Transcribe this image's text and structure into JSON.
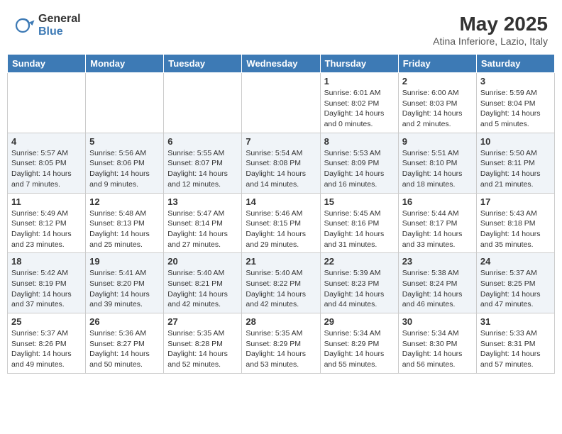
{
  "logo": {
    "general": "General",
    "blue": "Blue"
  },
  "title": "May 2025",
  "subtitle": "Atina Inferiore, Lazio, Italy",
  "weekdays": [
    "Sunday",
    "Monday",
    "Tuesday",
    "Wednesday",
    "Thursday",
    "Friday",
    "Saturday"
  ],
  "weeks": [
    [
      {
        "day": "",
        "detail": ""
      },
      {
        "day": "",
        "detail": ""
      },
      {
        "day": "",
        "detail": ""
      },
      {
        "day": "",
        "detail": ""
      },
      {
        "day": "1",
        "detail": "Sunrise: 6:01 AM\nSunset: 8:02 PM\nDaylight: 14 hours\nand 0 minutes."
      },
      {
        "day": "2",
        "detail": "Sunrise: 6:00 AM\nSunset: 8:03 PM\nDaylight: 14 hours\nand 2 minutes."
      },
      {
        "day": "3",
        "detail": "Sunrise: 5:59 AM\nSunset: 8:04 PM\nDaylight: 14 hours\nand 5 minutes."
      }
    ],
    [
      {
        "day": "4",
        "detail": "Sunrise: 5:57 AM\nSunset: 8:05 PM\nDaylight: 14 hours\nand 7 minutes."
      },
      {
        "day": "5",
        "detail": "Sunrise: 5:56 AM\nSunset: 8:06 PM\nDaylight: 14 hours\nand 9 minutes."
      },
      {
        "day": "6",
        "detail": "Sunrise: 5:55 AM\nSunset: 8:07 PM\nDaylight: 14 hours\nand 12 minutes."
      },
      {
        "day": "7",
        "detail": "Sunrise: 5:54 AM\nSunset: 8:08 PM\nDaylight: 14 hours\nand 14 minutes."
      },
      {
        "day": "8",
        "detail": "Sunrise: 5:53 AM\nSunset: 8:09 PM\nDaylight: 14 hours\nand 16 minutes."
      },
      {
        "day": "9",
        "detail": "Sunrise: 5:51 AM\nSunset: 8:10 PM\nDaylight: 14 hours\nand 18 minutes."
      },
      {
        "day": "10",
        "detail": "Sunrise: 5:50 AM\nSunset: 8:11 PM\nDaylight: 14 hours\nand 21 minutes."
      }
    ],
    [
      {
        "day": "11",
        "detail": "Sunrise: 5:49 AM\nSunset: 8:12 PM\nDaylight: 14 hours\nand 23 minutes."
      },
      {
        "day": "12",
        "detail": "Sunrise: 5:48 AM\nSunset: 8:13 PM\nDaylight: 14 hours\nand 25 minutes."
      },
      {
        "day": "13",
        "detail": "Sunrise: 5:47 AM\nSunset: 8:14 PM\nDaylight: 14 hours\nand 27 minutes."
      },
      {
        "day": "14",
        "detail": "Sunrise: 5:46 AM\nSunset: 8:15 PM\nDaylight: 14 hours\nand 29 minutes."
      },
      {
        "day": "15",
        "detail": "Sunrise: 5:45 AM\nSunset: 8:16 PM\nDaylight: 14 hours\nand 31 minutes."
      },
      {
        "day": "16",
        "detail": "Sunrise: 5:44 AM\nSunset: 8:17 PM\nDaylight: 14 hours\nand 33 minutes."
      },
      {
        "day": "17",
        "detail": "Sunrise: 5:43 AM\nSunset: 8:18 PM\nDaylight: 14 hours\nand 35 minutes."
      }
    ],
    [
      {
        "day": "18",
        "detail": "Sunrise: 5:42 AM\nSunset: 8:19 PM\nDaylight: 14 hours\nand 37 minutes."
      },
      {
        "day": "19",
        "detail": "Sunrise: 5:41 AM\nSunset: 8:20 PM\nDaylight: 14 hours\nand 39 minutes."
      },
      {
        "day": "20",
        "detail": "Sunrise: 5:40 AM\nSunset: 8:21 PM\nDaylight: 14 hours\nand 42 minutes."
      },
      {
        "day": "21",
        "detail": "Sunrise: 5:40 AM\nSunset: 8:22 PM\nDaylight: 14 hours\nand 42 minutes."
      },
      {
        "day": "22",
        "detail": "Sunrise: 5:39 AM\nSunset: 8:23 PM\nDaylight: 14 hours\nand 44 minutes."
      },
      {
        "day": "23",
        "detail": "Sunrise: 5:38 AM\nSunset: 8:24 PM\nDaylight: 14 hours\nand 46 minutes."
      },
      {
        "day": "24",
        "detail": "Sunrise: 5:37 AM\nSunset: 8:25 PM\nDaylight: 14 hours\nand 47 minutes."
      }
    ],
    [
      {
        "day": "25",
        "detail": "Sunrise: 5:37 AM\nSunset: 8:26 PM\nDaylight: 14 hours\nand 49 minutes."
      },
      {
        "day": "26",
        "detail": "Sunrise: 5:36 AM\nSunset: 8:27 PM\nDaylight: 14 hours\nand 50 minutes."
      },
      {
        "day": "27",
        "detail": "Sunrise: 5:35 AM\nSunset: 8:28 PM\nDaylight: 14 hours\nand 52 minutes."
      },
      {
        "day": "28",
        "detail": "Sunrise: 5:35 AM\nSunset: 8:29 PM\nDaylight: 14 hours\nand 53 minutes."
      },
      {
        "day": "29",
        "detail": "Sunrise: 5:34 AM\nSunset: 8:29 PM\nDaylight: 14 hours\nand 55 minutes."
      },
      {
        "day": "30",
        "detail": "Sunrise: 5:34 AM\nSunset: 8:30 PM\nDaylight: 14 hours\nand 56 minutes."
      },
      {
        "day": "31",
        "detail": "Sunrise: 5:33 AM\nSunset: 8:31 PM\nDaylight: 14 hours\nand 57 minutes."
      }
    ]
  ]
}
